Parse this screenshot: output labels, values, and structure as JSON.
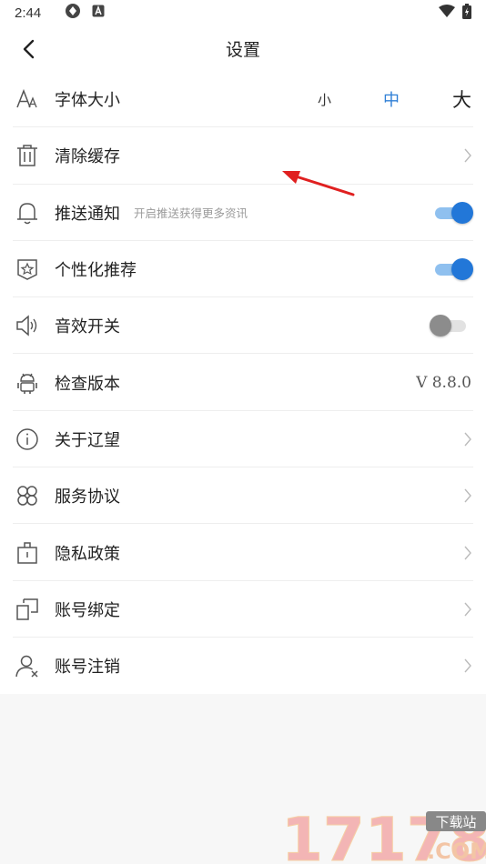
{
  "status": {
    "time": "2:44"
  },
  "nav": {
    "title": "设置"
  },
  "font_size": {
    "label": "字体大小",
    "small": "小",
    "medium": "中",
    "large": "大"
  },
  "clear_cache": {
    "label": "清除缓存"
  },
  "push": {
    "label": "推送通知",
    "sub": "开启推送获得更多资讯",
    "on": true
  },
  "personalized": {
    "label": "个性化推荐",
    "on": true
  },
  "sound": {
    "label": "音效开关",
    "on": false
  },
  "version": {
    "label": "检查版本",
    "value": "V 8.8.0"
  },
  "about": {
    "label": "关于辽望"
  },
  "agreement": {
    "label": "服务协议"
  },
  "privacy": {
    "label": "隐私政策"
  },
  "bind": {
    "label": "账号绑定"
  },
  "cancel": {
    "label": "账号注销"
  },
  "colors": {
    "accent": "#2277d8",
    "accent_light": "#8fc0ef",
    "annotation_arrow": "#e02020"
  },
  "watermark": {
    "text": "17178",
    "badge": "下载站",
    "domain": ".COM"
  }
}
